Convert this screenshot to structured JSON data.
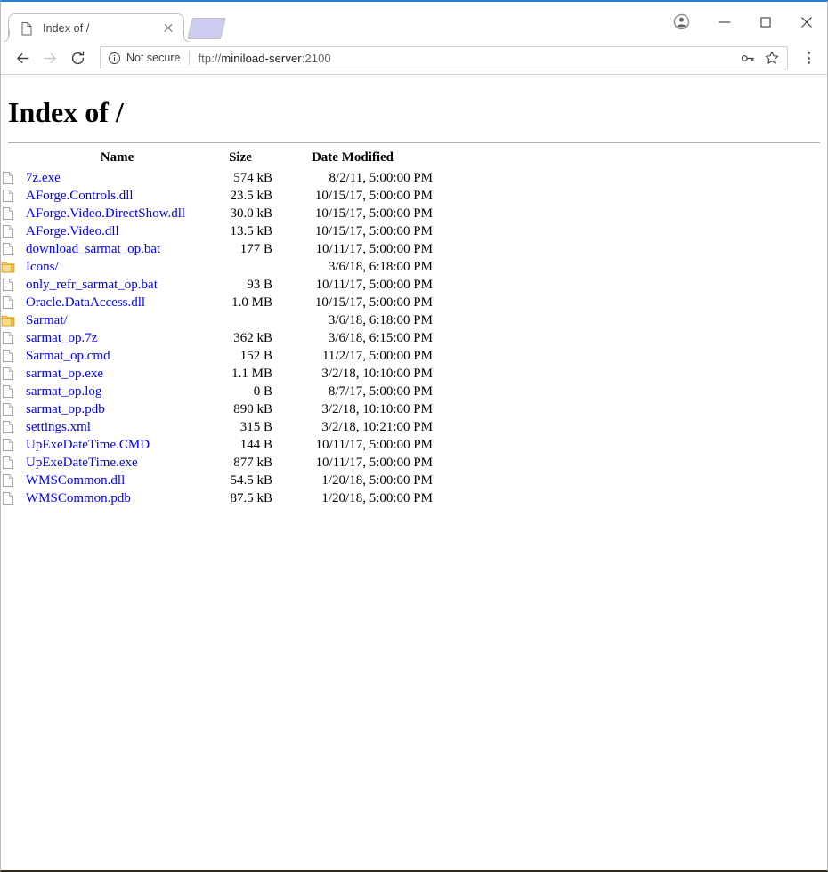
{
  "browser": {
    "tab": {
      "title": "Index of /",
      "favicon": "page-icon",
      "close_label": "Close tab"
    },
    "window_controls": {
      "profile": "profile-avatar-icon",
      "minimize": "minimize-icon",
      "maximize": "maximize-icon",
      "close": "close-icon"
    },
    "toolbar": {
      "back": "back-arrow-icon",
      "forward": "forward-arrow-icon",
      "reload": "reload-icon",
      "security_icon": "info-circle-icon",
      "security_label": "Not secure",
      "url_scheme": "ftp://",
      "url_host": "miniload-server",
      "url_port": ":2100",
      "url_full": "ftp://miniload-server:2100",
      "key_icon": "key-icon",
      "bookmark_icon": "star-icon",
      "menu_icon": "three-dot-menu-icon"
    }
  },
  "page": {
    "title": "Index of /",
    "columns": {
      "name": "Name",
      "size": "Size",
      "date": "Date Modified"
    },
    "entries": [
      {
        "icon": "file",
        "name": "7z.exe",
        "size": "574 kB",
        "date": "8/2/11, 5:00:00 PM"
      },
      {
        "icon": "file",
        "name": "AForge.Controls.dll",
        "size": "23.5 kB",
        "date": "10/15/17, 5:00:00 PM"
      },
      {
        "icon": "file",
        "name": "AForge.Video.DirectShow.dll",
        "size": "30.0 kB",
        "date": "10/15/17, 5:00:00 PM"
      },
      {
        "icon": "file",
        "name": "AForge.Video.dll",
        "size": "13.5 kB",
        "date": "10/15/17, 5:00:00 PM"
      },
      {
        "icon": "file",
        "name": "download_sarmat_op.bat",
        "size": "177 B",
        "date": "10/11/17, 5:00:00 PM"
      },
      {
        "icon": "folder",
        "name": "Icons/",
        "size": "",
        "date": "3/6/18, 6:18:00 PM"
      },
      {
        "icon": "file",
        "name": "only_refr_sarmat_op.bat",
        "size": "93 B",
        "date": "10/11/17, 5:00:00 PM"
      },
      {
        "icon": "file",
        "name": "Oracle.DataAccess.dll",
        "size": "1.0 MB",
        "date": "10/15/17, 5:00:00 PM"
      },
      {
        "icon": "folder",
        "name": "Sarmat/",
        "size": "",
        "date": "3/6/18, 6:18:00 PM"
      },
      {
        "icon": "file",
        "name": "sarmat_op.7z",
        "size": "362 kB",
        "date": "3/6/18, 6:15:00 PM"
      },
      {
        "icon": "file",
        "name": "Sarmat_op.cmd",
        "size": "152 B",
        "date": "11/2/17, 5:00:00 PM"
      },
      {
        "icon": "file",
        "name": "sarmat_op.exe",
        "size": "1.1 MB",
        "date": "3/2/18, 10:10:00 PM"
      },
      {
        "icon": "file",
        "name": "sarmat_op.log",
        "size": "0 B",
        "date": "8/7/17, 5:00:00 PM"
      },
      {
        "icon": "file",
        "name": "sarmat_op.pdb",
        "size": "890 kB",
        "date": "3/2/18, 10:10:00 PM"
      },
      {
        "icon": "file",
        "name": "settings.xml",
        "size": "315 B",
        "date": "3/2/18, 10:21:00 PM"
      },
      {
        "icon": "file",
        "name": "UpExeDateTime.CMD",
        "size": "144 B",
        "date": "10/11/17, 5:00:00 PM"
      },
      {
        "icon": "file",
        "name": "UpExeDateTime.exe",
        "size": "877 kB",
        "date": "10/11/17, 5:00:00 PM"
      },
      {
        "icon": "file",
        "name": "WMSCommon.dll",
        "size": "54.5 kB",
        "date": "1/20/18, 5:00:00 PM"
      },
      {
        "icon": "file",
        "name": "WMSCommon.pdb",
        "size": "87.5 kB",
        "date": "1/20/18, 5:00:00 PM"
      }
    ]
  },
  "colors": {
    "link": "#0000ee",
    "window_border_top": "#2a7fd4",
    "folder_icon": "#f4bd4f",
    "text": "#000000",
    "url_host": "#202124",
    "url_dim": "#5f6368"
  }
}
